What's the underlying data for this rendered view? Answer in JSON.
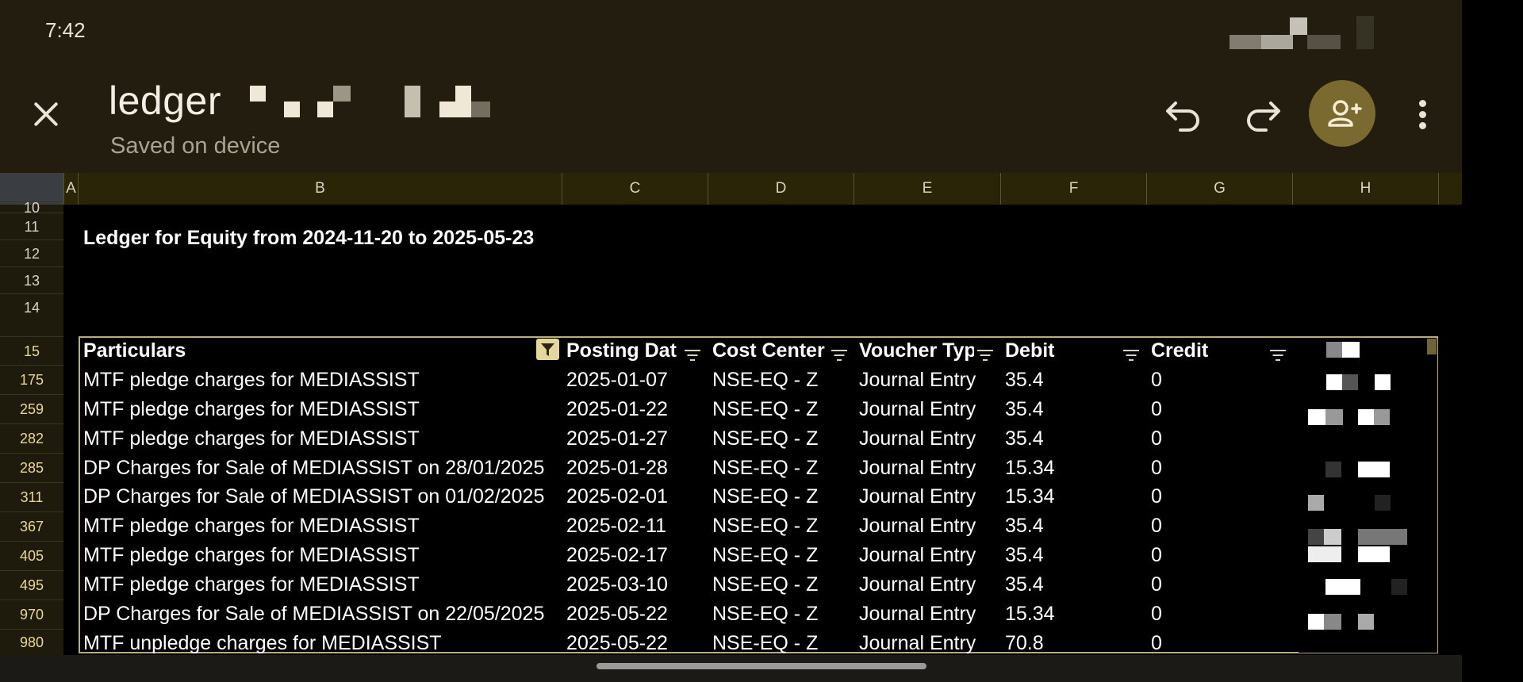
{
  "status_bar": {
    "time": "7:42"
  },
  "app_bar": {
    "doc_title": "ledger",
    "save_status": "Saved on device",
    "accent_color": "#7b6a2f"
  },
  "columns": [
    "A",
    "B",
    "C",
    "D",
    "E",
    "F",
    "G",
    "H"
  ],
  "row_numbers": [
    "10",
    "11",
    "12",
    "13",
    "14",
    "15",
    "175",
    "259",
    "282",
    "285",
    "311",
    "367",
    "405",
    "495",
    "970",
    "980"
  ],
  "sheet": {
    "title": "Ledger for Equity from 2024-11-20 to 2025-05-23",
    "headers": [
      "Particulars",
      "Posting Dat",
      "Cost Center",
      "Voucher Typ",
      "Debit",
      "Credit"
    ],
    "rows": [
      [
        "MTF pledge charges for MEDIASSIST",
        "2025-01-07",
        "NSE-EQ - Z",
        "Journal Entry",
        "35.4",
        "0"
      ],
      [
        "MTF pledge charges for MEDIASSIST",
        "2025-01-22",
        "NSE-EQ - Z",
        "Journal Entry",
        "35.4",
        "0"
      ],
      [
        "MTF pledge charges for MEDIASSIST",
        "2025-01-27",
        "NSE-EQ - Z",
        "Journal Entry",
        "35.4",
        "0"
      ],
      [
        "DP Charges for Sale of MEDIASSIST on 28/01/2025",
        "2025-01-28",
        "NSE-EQ - Z",
        "Journal Entry",
        "15.34",
        "0"
      ],
      [
        "DP Charges for Sale of MEDIASSIST on 01/02/2025",
        "2025-02-01",
        "NSE-EQ - Z",
        "Journal Entry",
        "15.34",
        "0"
      ],
      [
        "MTF pledge charges for MEDIASSIST",
        "2025-02-11",
        "NSE-EQ - Z",
        "Journal Entry",
        "35.4",
        "0"
      ],
      [
        "MTF pledge charges for MEDIASSIST",
        "2025-02-17",
        "NSE-EQ - Z",
        "Journal Entry",
        "35.4",
        "0"
      ],
      [
        "MTF pledge charges for MEDIASSIST",
        "2025-03-10",
        "NSE-EQ - Z",
        "Journal Entry",
        "35.4",
        "0"
      ],
      [
        "DP Charges for Sale of MEDIASSIST on 22/05/2025",
        "2025-05-22",
        "NSE-EQ - Z",
        "Journal Entry",
        "15.34",
        "0"
      ],
      [
        "MTF unpledge charges for MEDIASSIST",
        "2025-05-22",
        "NSE-EQ - Z",
        "Journal Entry",
        "70.8",
        "0"
      ]
    ]
  }
}
